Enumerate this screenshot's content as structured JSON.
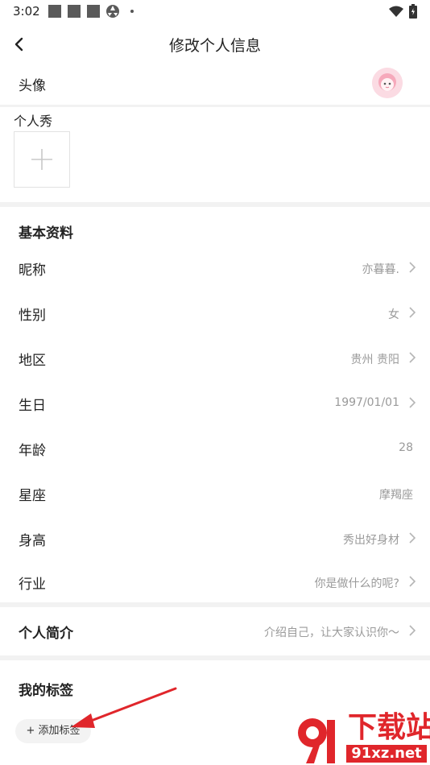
{
  "status": {
    "time": "3:02"
  },
  "header": {
    "title": "修改个人信息"
  },
  "avatar_row": {
    "label": "头像"
  },
  "show": {
    "label": "个人秀"
  },
  "basic": {
    "section_title": "基本资料",
    "rows": [
      {
        "label": "昵称",
        "value": "亦暮暮."
      },
      {
        "label": "性别",
        "value": "女"
      },
      {
        "label": "地区",
        "value": "贵州 贵阳"
      },
      {
        "label": "生日",
        "value": "1997/01/01"
      },
      {
        "label": "年龄",
        "value": "28"
      },
      {
        "label": "星座",
        "value": "摩羯座"
      },
      {
        "label": "身高",
        "value": "秀出好身材"
      },
      {
        "label": "行业",
        "value": "你是做什么的呢?"
      }
    ]
  },
  "bio": {
    "label": "个人简介",
    "value": "介绍自己，让大家认识你～"
  },
  "tags": {
    "section_title": "我的标签",
    "add_label": "+ 添加标签"
  },
  "watermark": {
    "main": "下载站",
    "domain": "91xz.net"
  },
  "colors": {
    "accent_red": "#e0262b",
    "value_gray": "#9a9a9a"
  }
}
